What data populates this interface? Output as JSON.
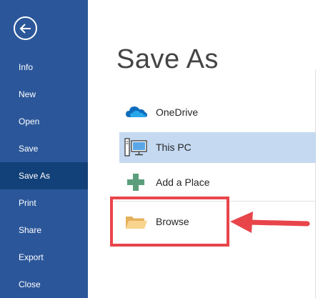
{
  "sidebar": {
    "items": [
      {
        "label": "Info"
      },
      {
        "label": "New"
      },
      {
        "label": "Open"
      },
      {
        "label": "Save"
      },
      {
        "label": "Save As",
        "active": true
      },
      {
        "label": "Print"
      },
      {
        "label": "Share"
      },
      {
        "label": "Export"
      },
      {
        "label": "Close"
      }
    ]
  },
  "main": {
    "title": "Save As",
    "locations": [
      {
        "label": "OneDrive",
        "icon": "cloud-icon"
      },
      {
        "label": "This PC",
        "icon": "computer-icon",
        "selected": true
      },
      {
        "label": "Add a Place",
        "icon": "plus-icon"
      },
      {
        "label": "Browse",
        "icon": "folder-icon"
      }
    ]
  },
  "colors": {
    "sidebar": "#2b579a",
    "sidebar_active": "#124078",
    "selected": "#c5d9f1",
    "annotation": "#e8454b"
  }
}
